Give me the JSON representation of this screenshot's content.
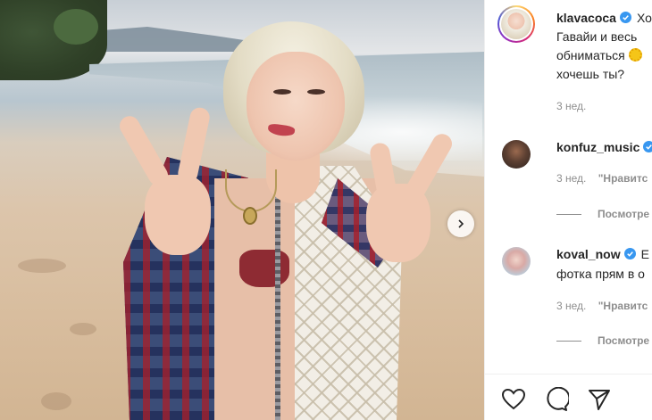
{
  "post": {
    "author": {
      "username": "klavacoca",
      "verified": true,
      "avatar_icon": "profile-avatar"
    },
    "caption_lines": [
      "Хо",
      "Гавайи и весь",
      "обниматься",
      "хочешь ты?"
    ],
    "caption_emoji": "sun",
    "caption_time": "3 нед."
  },
  "comments": [
    {
      "username": "konfuz_music",
      "verified": true,
      "text": "",
      "time": "3 нед.",
      "like_label": "\"Нравитс",
      "replies_label": "Посмотре"
    },
    {
      "username": "koval_now",
      "verified": true,
      "text_lines": [
        "Е",
        "фотка прям в о"
      ],
      "time": "3 нед.",
      "like_label": "\"Нравитс",
      "replies_label": "Посмотре"
    }
  ],
  "actions": {
    "like_icon": "heart-icon",
    "comment_icon": "comment-icon",
    "share_icon": "paper-plane-icon"
  },
  "carousel": {
    "next_icon": "chevron-right-icon"
  },
  "colors": {
    "text": "#262626",
    "secondary": "#8e8e8e",
    "verified_blue": "#3897f0",
    "border": "#efefef"
  }
}
